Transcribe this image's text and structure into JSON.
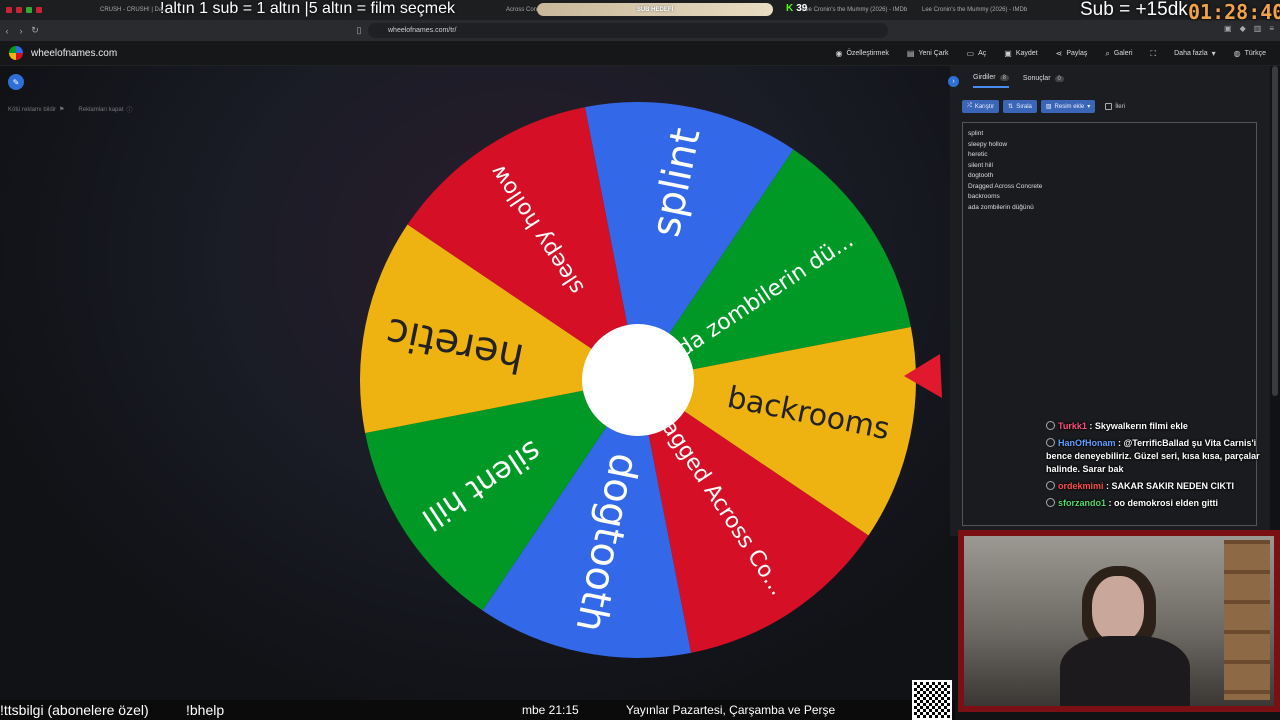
{
  "browser": {
    "tabs": [
      {
        "label": "CRUSH - CRUSH! | Da...",
        "fav": "red"
      },
      {
        "label": "Across Conc",
        "fav": "red"
      },
      {
        "label": "Lee Cronin's the Mummy (2026) - IMDb",
        "fav": "yellow"
      },
      {
        "label": "Lee Cronin's the Mummy (2026) - IMDb",
        "fav": "yellow"
      }
    ],
    "url": "wheelofnames.com/tr/"
  },
  "site": {
    "name": "wheelofnames.com",
    "menu": [
      "Özelleştirmek",
      "Yeni Çark",
      "Aç",
      "Kaydet",
      "Paylaş",
      "Galeri",
      "Daha fazla",
      "Türkçe"
    ]
  },
  "ads": {
    "report": "Kötü reklamı bildir",
    "close": "Reklamları kapat"
  },
  "wheel": {
    "entries": [
      "splint",
      "ada zombilerin dü...",
      "backrooms",
      "Dragged Across Co...",
      "dogtooth",
      "silent hill",
      "heretic",
      "sleepy hollow"
    ],
    "colors": [
      "#3369e8",
      "#009925",
      "#eeb211",
      "#d50f25",
      "#3369e8",
      "#009925",
      "#eeb211",
      "#d50f25"
    ]
  },
  "panel": {
    "tab_entries": "Girdiler",
    "tab_entries_count": "8",
    "tab_results": "Sonuçlar",
    "tab_results_count": "0",
    "btn_shuffle": "Karıştır",
    "btn_sort": "Sırala",
    "btn_add_image": "Resim ekle",
    "advanced": "İleri",
    "entry_list": [
      "splint",
      "sleepy hollow",
      "heretic",
      "silent hill",
      "dogtooth",
      "Dragged Across Concrete",
      "backrooms",
      "ada zombilerin düğünü"
    ]
  },
  "chat": [
    {
      "user": "Turkk1",
      "color": "#ff4b7d",
      "text": ": Skywalkerın filmi ekle"
    },
    {
      "user": "HanOfHonam",
      "color": "#5aa0ff",
      "text": ": @TerrificBallad şu Vita Carnis'i bence deneyebiliriz. Güzel seri, kısa kısa, parçalar halinde. Sarar bak"
    },
    {
      "user": "ordekmimi",
      "color": "#ff4b4b",
      "text": ": SAKAR SAKIR NEDEN CIKTI"
    },
    {
      "user": "sforzando1",
      "color": "#4cd96a",
      "text": ": oo demokrosi elden gitti"
    }
  ],
  "overlay": {
    "top_text": "!altın      1 sub = 1 altın  |5 altın = film seçmek",
    "sub_goal": "SUB HEDEFİ",
    "kick_count": "39",
    "sub_bonus": "Sub = +15dk",
    "timer": "01:28:40",
    "bottom_1": "!ttsbilgi (abonelere özel)",
    "bottom_2": "!bhelp",
    "bottom_3": "mbe 21:15",
    "bottom_4": "Yayınlar Pazartesi, Çarşamba ve Perşe"
  }
}
